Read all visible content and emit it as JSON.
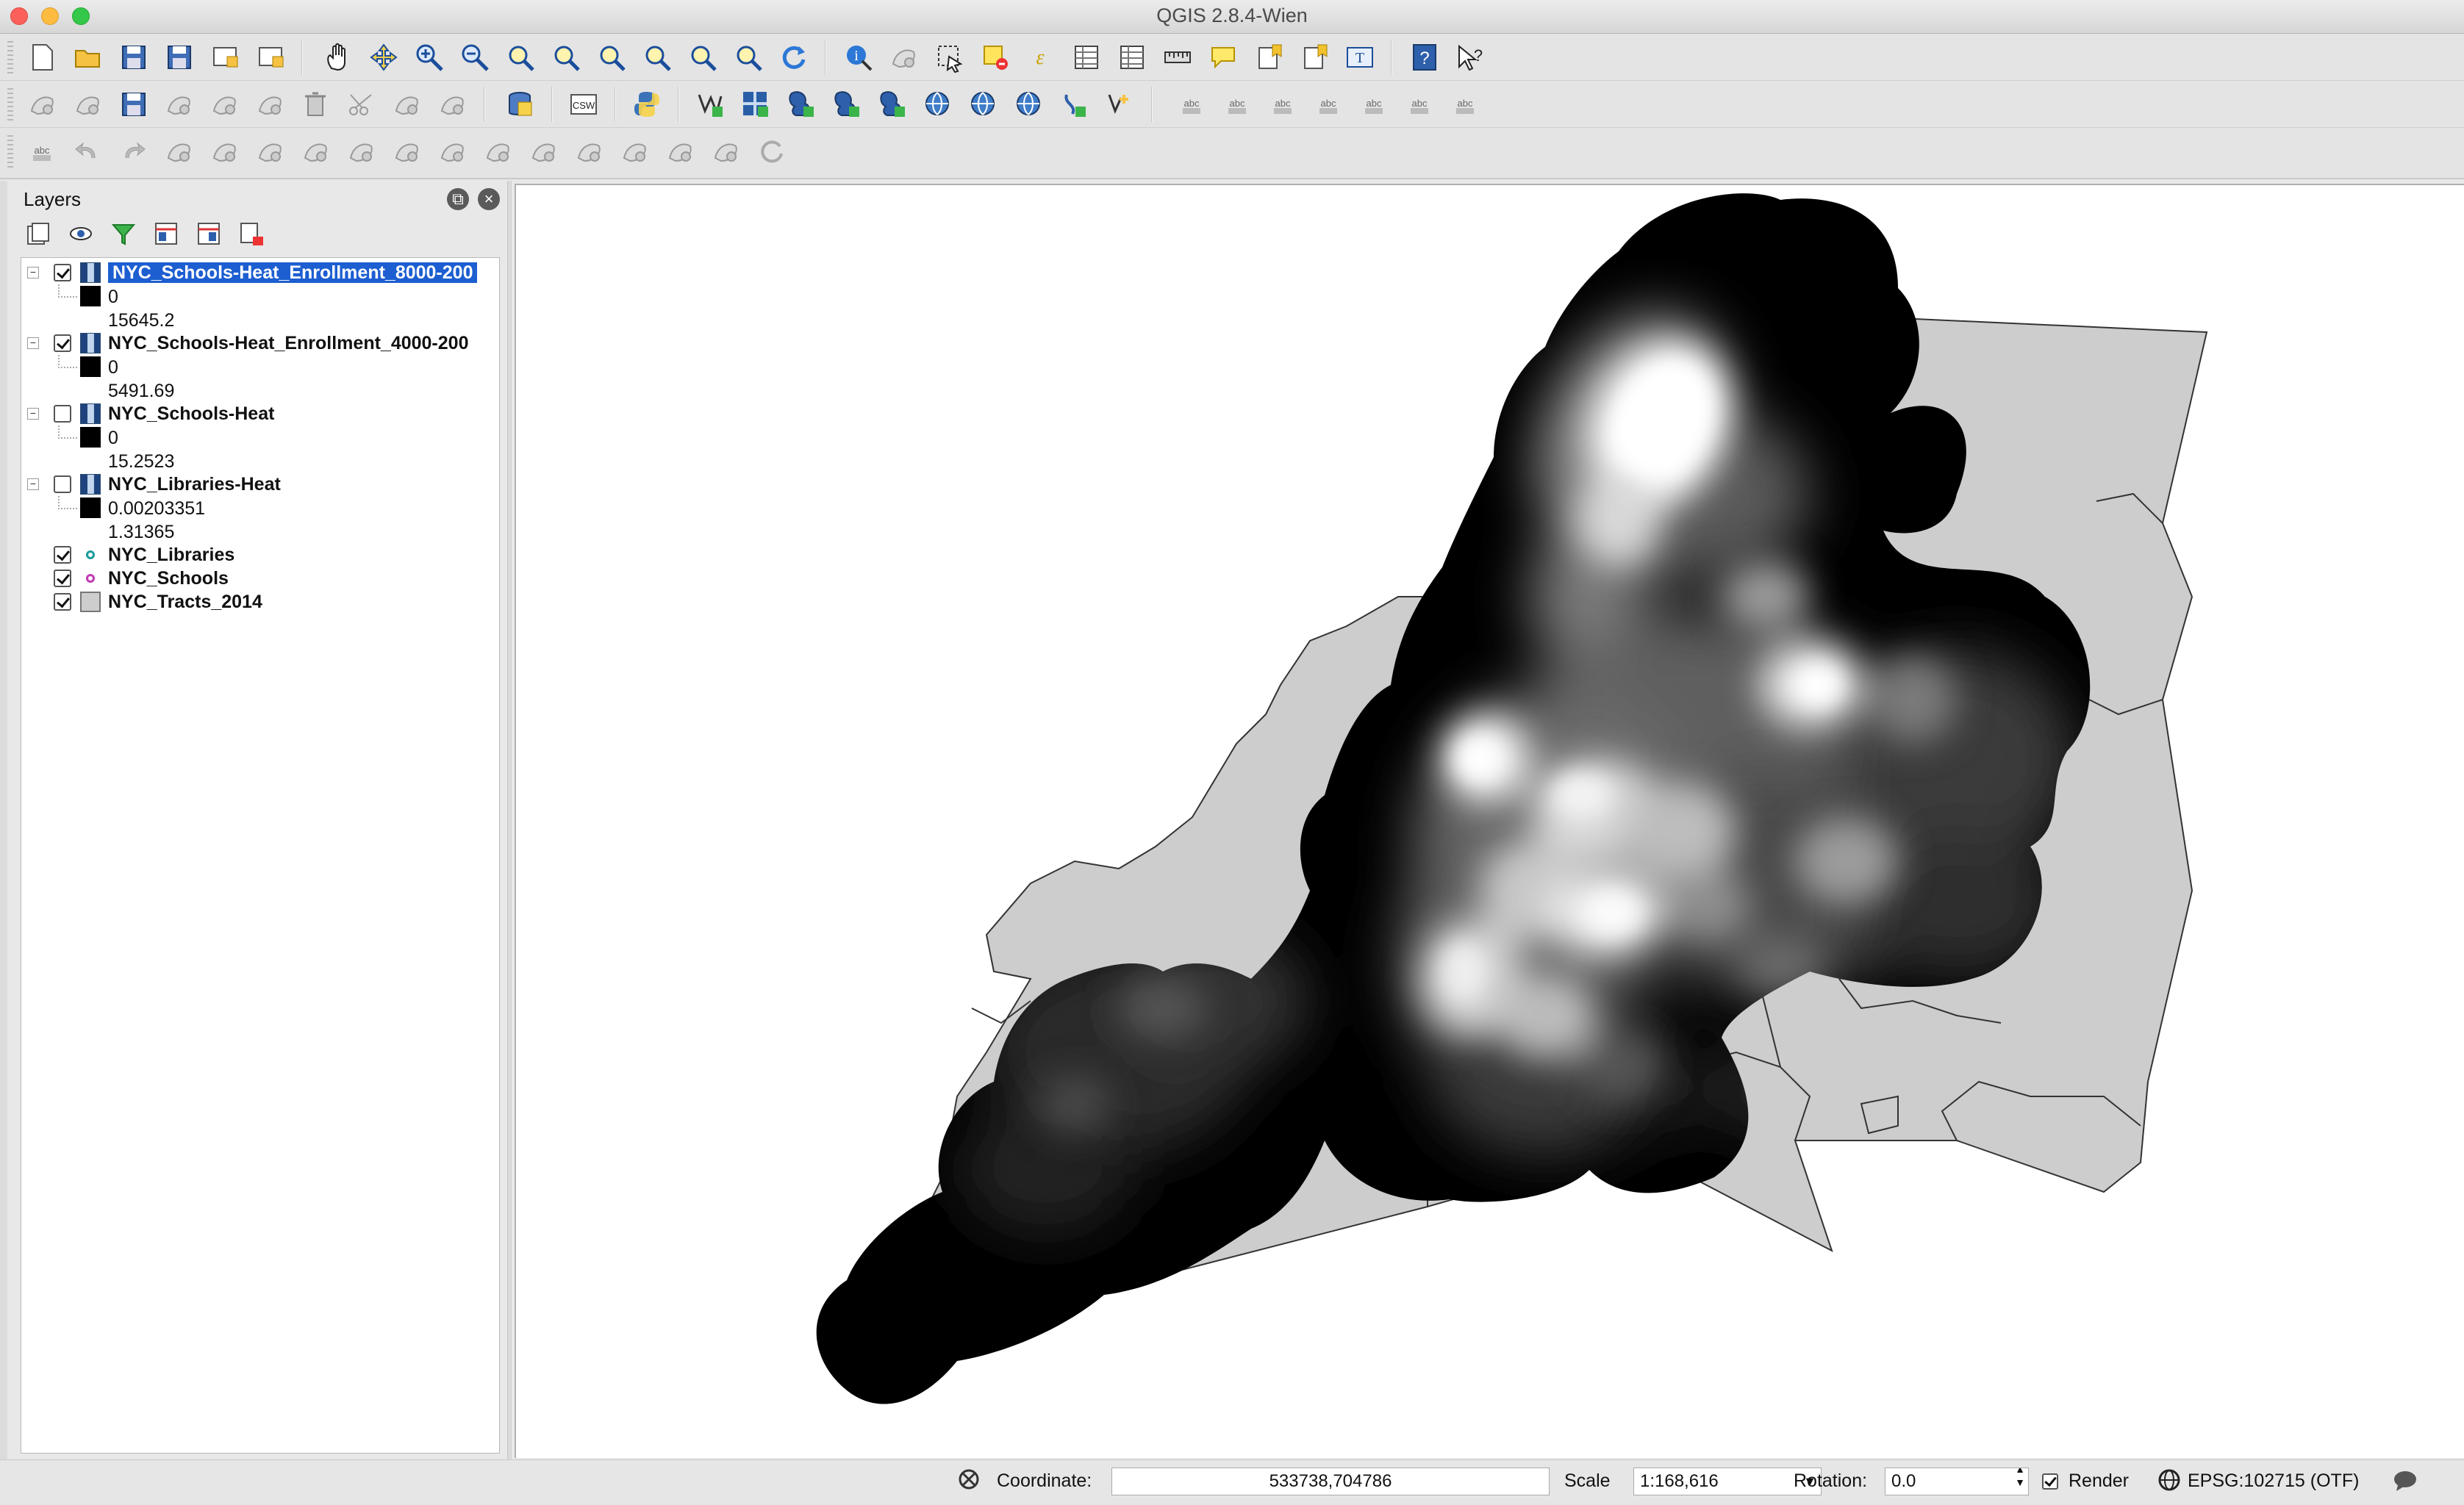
{
  "window": {
    "title": "QGIS 2.8.4-Wien"
  },
  "toolbar_icons": {
    "row1": [
      "new-project-icon",
      "open-project-icon",
      "save-project-icon",
      "save-as-icon",
      "new-print-composer-icon",
      "composer-manager-icon",
      "pan-icon",
      "pan-to-selection-icon",
      "zoom-in-icon",
      "zoom-out-icon",
      "zoom-native-icon",
      "zoom-full-icon",
      "zoom-to-selection-icon",
      "zoom-to-layer-icon",
      "zoom-last-icon",
      "zoom-next-icon",
      "refresh-icon",
      "identify-icon",
      "map-tips-icon",
      "select-features-icon",
      "deselect-icon",
      "expression-select-icon",
      "attribute-table-icon",
      "field-calculator-icon",
      "measure-icon",
      "map-tips-balloon-icon",
      "new-bookmark-icon",
      "show-bookmarks-icon",
      "text-annotation-icon",
      "help-icon",
      "whats-this-icon"
    ],
    "row2": [
      "current-edits-icon",
      "toggle-editing-icon",
      "save-edits-icon",
      "add-feature-icon",
      "move-feature-icon",
      "node-tool-icon",
      "delete-selected-icon",
      "cut-features-icon",
      "copy-features-icon",
      "paste-features-icon",
      "db-manager-icon",
      "csw-icon",
      "python-console-icon",
      "add-vector-layer-icon",
      "add-raster-layer-icon",
      "add-postgis-layer-icon",
      "add-spatialite-layer-icon",
      "add-mssql-layer-icon",
      "add-wms-layer-icon",
      "add-wcs-layer-icon",
      "add-wfs-layer-icon",
      "add-delimited-text-icon",
      "new-shapefile-icon",
      "label-toolbar-icon",
      "label-highlight-icon",
      "pin-labels-icon",
      "show-hide-labels-icon",
      "move-label-icon",
      "rotate-label-icon",
      "change-label-icon"
    ],
    "row3": [
      "snapping-icon",
      "undo-icon",
      "redo-icon",
      "rotate-feature-icon",
      "simplify-feature-icon",
      "add-ring-icon",
      "add-part-icon",
      "fill-ring-icon",
      "delete-ring-icon",
      "delete-part-icon",
      "reshape-features-icon",
      "offset-curve-icon",
      "split-features-icon",
      "split-parts-icon",
      "merge-selected-icon",
      "merge-attributes-icon",
      "rotate-point-symbols-icon"
    ]
  },
  "layers_panel": {
    "title": "Layers",
    "tools": [
      "add-group-icon",
      "manage-visibility-icon",
      "filter-legend-icon",
      "expand-all-icon",
      "collapse-all-icon",
      "remove-layer-icon"
    ],
    "items": [
      {
        "name": "NYC_Schools-Heat_Enrollment_8000-200",
        "checked": true,
        "type": "raster",
        "selected": true,
        "legend_min": "0",
        "legend_max": "15645.2"
      },
      {
        "name": "NYC_Schools-Heat_Enrollment_4000-200",
        "checked": true,
        "type": "raster",
        "selected": false,
        "legend_min": "0",
        "legend_max": "5491.69"
      },
      {
        "name": "NYC_Schools-Heat",
        "checked": false,
        "type": "raster",
        "selected": false,
        "legend_min": "0",
        "legend_max": "15.2523"
      },
      {
        "name": "NYC_Libraries-Heat",
        "checked": false,
        "type": "raster",
        "selected": false,
        "legend_min": "0.00203351",
        "legend_max": "1.31365"
      },
      {
        "name": "NYC_Libraries",
        "checked": true,
        "type": "point",
        "color": "#1a9b9b"
      },
      {
        "name": "NYC_Schools",
        "checked": true,
        "type": "point",
        "color": "#c23ab3"
      },
      {
        "name": "NYC_Tracts_2014",
        "checked": true,
        "type": "polygon",
        "color": "#cdcdcd"
      }
    ]
  },
  "statusbar": {
    "coordinate_label": "Coordinate:",
    "coordinate_value": "533738,704786",
    "scale_label": "Scale",
    "scale_value": "1:168,616",
    "rotation_label": "Rotation:",
    "rotation_value": "0.0",
    "render_label": "Render",
    "render_checked": true,
    "crs": "EPSG:102715 (OTF)"
  },
  "colors": {
    "selection": "#1d5ed1",
    "tracts_fill": "#cdcdcd",
    "heat_low": "#000000",
    "heat_high": "#ffffff"
  }
}
